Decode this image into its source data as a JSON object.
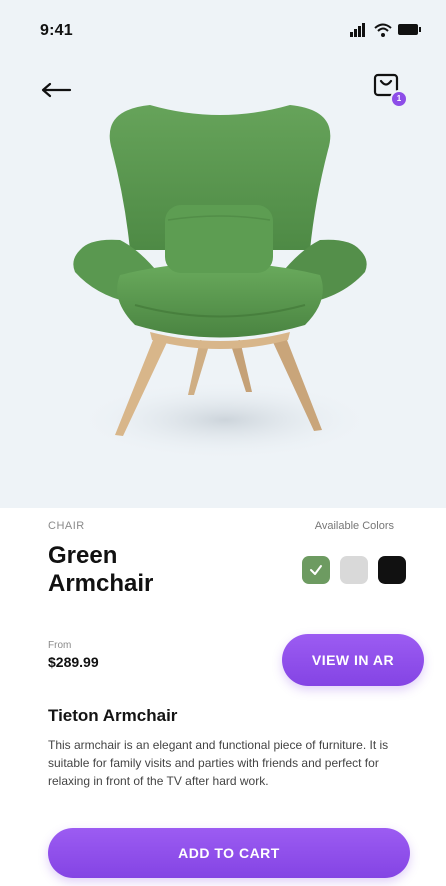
{
  "status_bar": {
    "time": "9:41",
    "icons": [
      "signal-icon",
      "wifi-icon",
      "battery-icon"
    ]
  },
  "header": {
    "back_icon": "arrow-left-icon",
    "cart_icon": "cart-icon",
    "cart_badge": "1"
  },
  "product": {
    "image_icon": "green-armchair-image",
    "category": "CHAIR",
    "title_line1": "Green",
    "title_line2": "Armchair",
    "colors_label": "Available Colors",
    "swatches": [
      {
        "name": "green",
        "color": "#6d9b61",
        "selected": true
      },
      {
        "name": "light-gray",
        "color": "#d9d9d9",
        "selected": false
      },
      {
        "name": "black",
        "color": "#111111",
        "selected": false
      }
    ],
    "price_from_label": "From",
    "price": "$289.99",
    "view_ar_label": "VIEW IN AR",
    "desc_title": "Tieton Armchair",
    "desc_text": "This armchair is an elegant and functional piece of furniture. It is suitable for family visits and parties with friends and perfect for relaxing in front of the TV after hard work.",
    "add_to_cart_label": "ADD TO CART"
  },
  "colors": {
    "accent": "#8d4de8",
    "hero_bg": "#eef3f7",
    "chair_green": "#5f9a53",
    "wood": "#d8b68a"
  }
}
